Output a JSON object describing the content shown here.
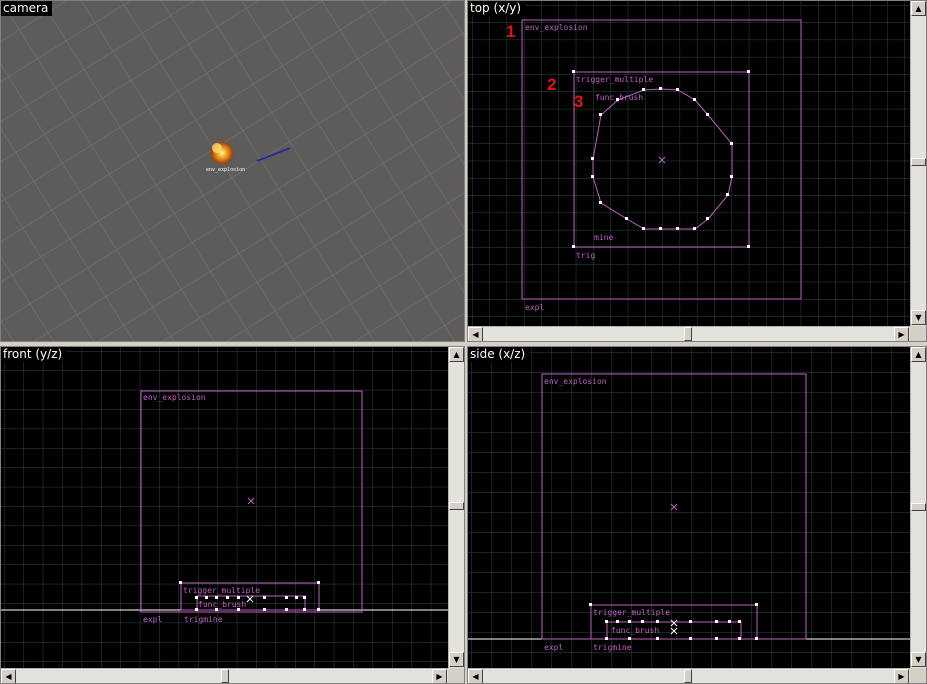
{
  "viewports": {
    "camera": {
      "label": "camera"
    },
    "top": {
      "label": "top (x/y)"
    },
    "front": {
      "label": "front (y/z)"
    },
    "side": {
      "label": "side (x/z)"
    }
  },
  "camera_view": {
    "sprite_label": "env_explosion"
  },
  "top_view": {
    "env_label": "env_explosion",
    "trigger_label": "trigger_multiple",
    "func_label": "func_brush",
    "mine_label": "mine",
    "trig_label": "trig",
    "expl_label": "expl",
    "marker_1": "1",
    "marker_2": "2",
    "marker_3": "3"
  },
  "front_view": {
    "env_label": "env_explosion",
    "trigger_label": "trigger_multiple",
    "func_label": "func_brush",
    "expl_label": "expl",
    "trigmine_label": "trigmine"
  },
  "side_view": {
    "env_label": "env_explosion",
    "trigger_label": "trigger_multiple",
    "func_label": "func_brush",
    "expl_label": "expl",
    "trigmine_label": "trigmine"
  },
  "scroll_arrows": {
    "up": "▲",
    "down": "▼",
    "left": "◀",
    "right": "▶"
  },
  "colors": {
    "entity": "#c060c0",
    "grid_minor": "#233838",
    "grid_major": "#3c6e6e",
    "axis_line": "#ffffff",
    "camera_bg": "#5e5c5a",
    "marker": "#e81010"
  }
}
